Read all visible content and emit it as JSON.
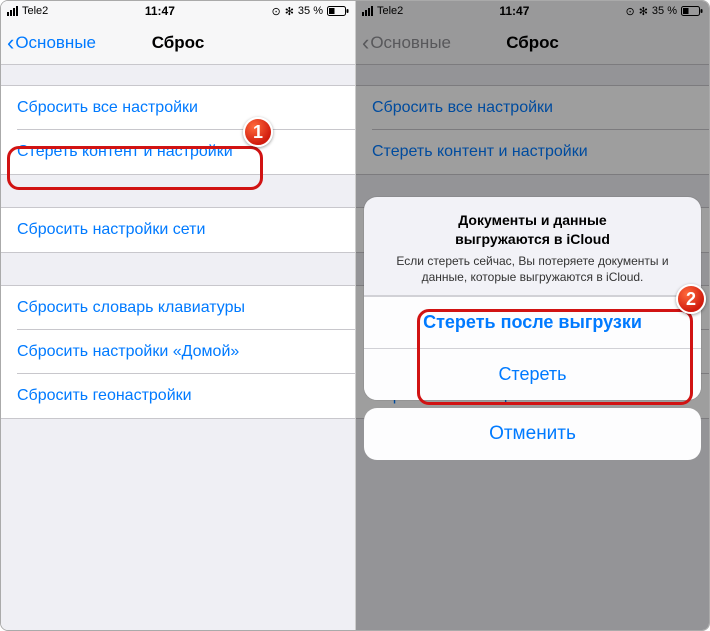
{
  "status": {
    "carrier": "Tele2",
    "time": "11:47",
    "battery_pct": "35 %",
    "bt_icon": "✻",
    "alarm_icon": "⊙"
  },
  "nav": {
    "back_label": "Основные",
    "title": "Сброс"
  },
  "groups": [
    {
      "rows": [
        {
          "label": "Сбросить все настройки",
          "name": "reset-all-settings"
        },
        {
          "label": "Стереть контент и настройки",
          "name": "erase-content-settings"
        }
      ]
    },
    {
      "rows": [
        {
          "label": "Сбросить настройки сети",
          "name": "reset-network"
        }
      ]
    },
    {
      "rows": [
        {
          "label": "Сбросить словарь клавиатуры",
          "name": "reset-keyboard-dict"
        },
        {
          "label": "Сбросить настройки «Домой»",
          "name": "reset-home-layout"
        },
        {
          "label": "Сбросить геонастройки",
          "name": "reset-location-privacy"
        }
      ]
    }
  ],
  "sheet": {
    "title_l1": "Документы и данные",
    "title_l2": "выгружаются в iCloud",
    "message": "Если стереть сейчас, Вы потеряете документы и данные, которые выгружаются в iCloud.",
    "btn_after": "Стереть после выгрузки",
    "btn_erase": "Стереть",
    "btn_cancel": "Отменить"
  },
  "annotations": {
    "badge1": "1",
    "badge2": "2"
  }
}
